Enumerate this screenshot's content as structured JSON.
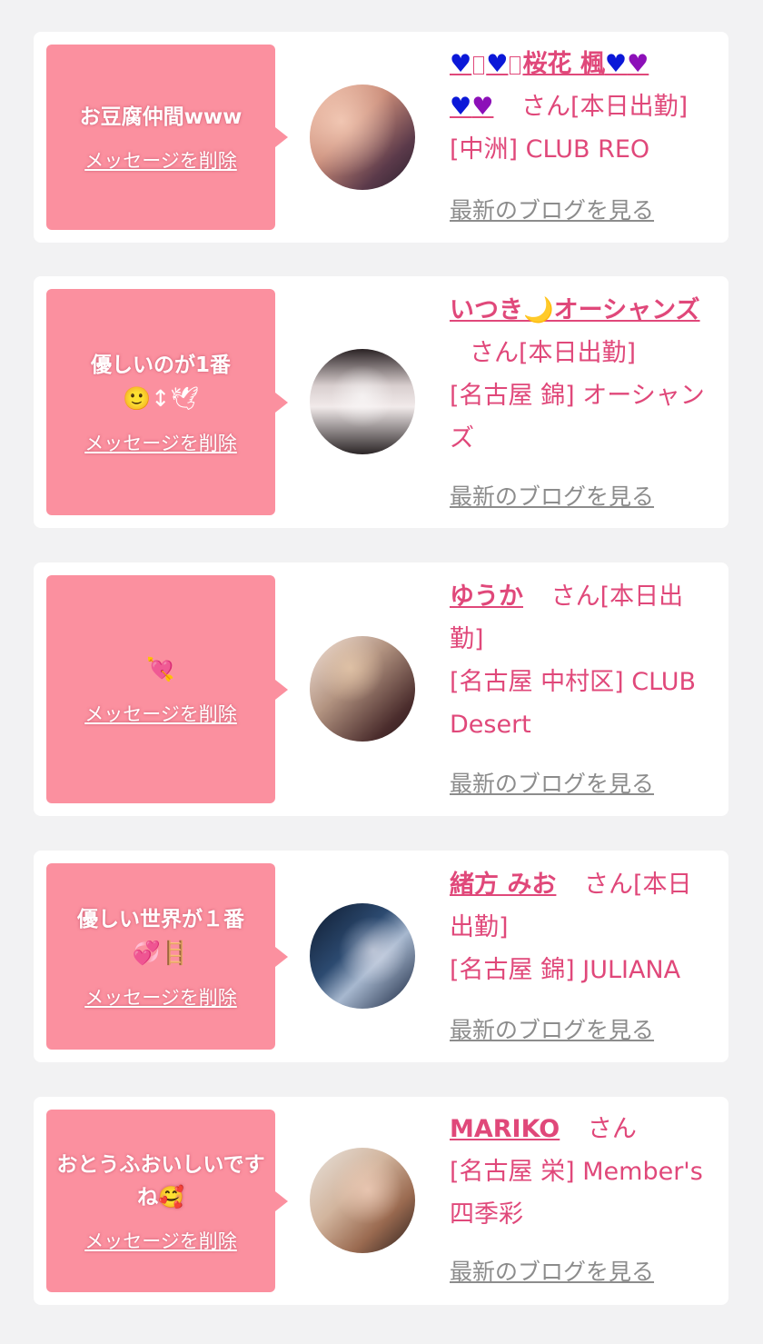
{
  "delete_label": "メッセージを削除",
  "blog_label": "最新のブログを見る",
  "san": "さん",
  "colors": {
    "bubble": "#fb909f",
    "accent": "#e0487a",
    "link_gray": "#8c8c8c",
    "bg": "#f2f2f3"
  },
  "cards": [
    {
      "message": "お豆腐仲間www",
      "message_emoji": "",
      "name": "桜花 楓",
      "name_prefix_icons": [
        "blue-heart",
        "missing-glyph",
        "blue-heart",
        "missing-glyph"
      ],
      "name_suffix_icons": [
        "blue-heart",
        "purple-heart",
        "blue-heart",
        "purple-heart"
      ],
      "status": "[本日出勤]",
      "shop": "[中洲] CLUB REO",
      "avatar": "avatar-photo"
    },
    {
      "message": "優しいのが1番",
      "message_emoji": "🙂↕🕊",
      "name": "いつき🌙オーシャンズ",
      "status": "[本日出勤]",
      "shop": "[名古屋 錦] オーシャンズ",
      "avatar": "avatar-photo"
    },
    {
      "message": "",
      "message_emoji": "💘",
      "name": "ゆうか",
      "status": "[本日出勤]",
      "shop": "[名古屋 中村区] CLUB Desert",
      "avatar": "avatar-photo"
    },
    {
      "message": "優しい世界が１番",
      "message_emoji": "💞🪜",
      "name": "緒方 みお",
      "status": "[本日出勤]",
      "shop": "[名古屋 錦] JULIANA",
      "avatar": "avatar-photo"
    },
    {
      "message": "おとうふおいしいですね🥰",
      "message_emoji": "",
      "name": "MARIKO",
      "status": "",
      "shop": "[名古屋 栄] Member's 四季彩",
      "avatar": "avatar-photo"
    }
  ]
}
